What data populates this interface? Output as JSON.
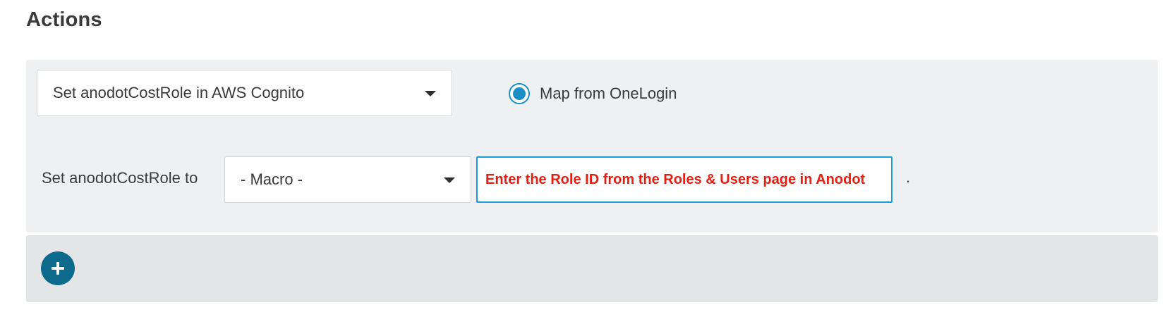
{
  "section": {
    "title": "Actions"
  },
  "action": {
    "selected_action": "Set anodotCostRole in AWS Cognito",
    "mapping_option": {
      "label": "Map from OneLogin",
      "selected": true
    },
    "set_label": "Set anodotCostRole to",
    "macro_selected": "- Macro -",
    "value_input": {
      "value": "",
      "placeholder": "Enter the Role ID from the Roles & Users page in Anodot"
    },
    "trailing_text": "."
  },
  "add": {
    "icon": "plus-icon"
  },
  "colors": {
    "accent": "#1a8fc7",
    "add_button": "#0c6a8c",
    "placeholder_text": "#e61e12",
    "panel_bg": "#eff0f2"
  }
}
